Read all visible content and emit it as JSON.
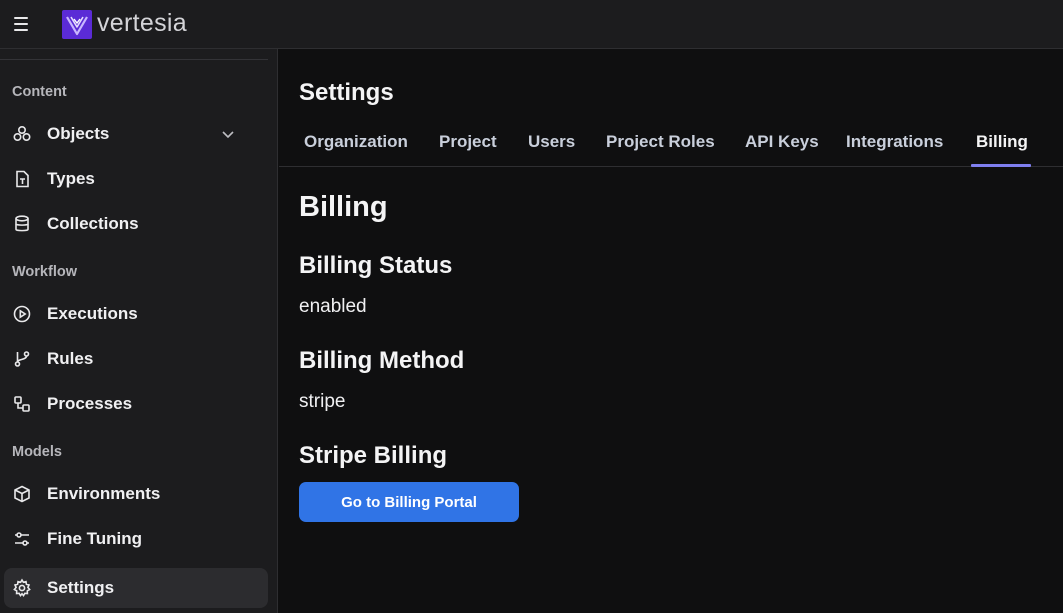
{
  "app": {
    "logo_text": "vertesia",
    "logo_icon": "vertesia-logo-icon"
  },
  "sidebar": {
    "sections": [
      {
        "label": "Content"
      },
      {
        "label": "Workflow"
      },
      {
        "label": "Models"
      }
    ],
    "items": [
      {
        "label": "Objects",
        "icon": "objects-icon",
        "expandable": true
      },
      {
        "label": "Types",
        "icon": "file-type-icon"
      },
      {
        "label": "Collections",
        "icon": "database-icon"
      },
      {
        "label": "Executions",
        "icon": "play-circle-icon"
      },
      {
        "label": "Rules",
        "icon": "git-branch-icon"
      },
      {
        "label": "Processes",
        "icon": "workflow-icon"
      },
      {
        "label": "Environments",
        "icon": "cube-icon"
      },
      {
        "label": "Fine Tuning",
        "icon": "sliders-icon"
      },
      {
        "label": "Settings",
        "icon": "gear-icon",
        "active": true
      }
    ]
  },
  "main": {
    "title": "Settings",
    "tabs": [
      {
        "label": "Organization"
      },
      {
        "label": "Project"
      },
      {
        "label": "Users"
      },
      {
        "label": "Project Roles"
      },
      {
        "label": "API Keys"
      },
      {
        "label": "Integrations"
      },
      {
        "label": "Billing",
        "active": true
      }
    ],
    "heading": "Billing",
    "billing_status_label": "Billing Status",
    "billing_status_value": "enabled",
    "billing_method_label": "Billing Method",
    "billing_method_value": "stripe",
    "stripe_billing_label": "Stripe Billing",
    "portal_button_label": "Go to Billing Portal"
  },
  "colors": {
    "accent": "#3074e6",
    "tab_underline": "#7f7ff0",
    "logo": "#5b2bd6",
    "background": "#0f0f10",
    "sidebar": "#1c1c1e"
  }
}
